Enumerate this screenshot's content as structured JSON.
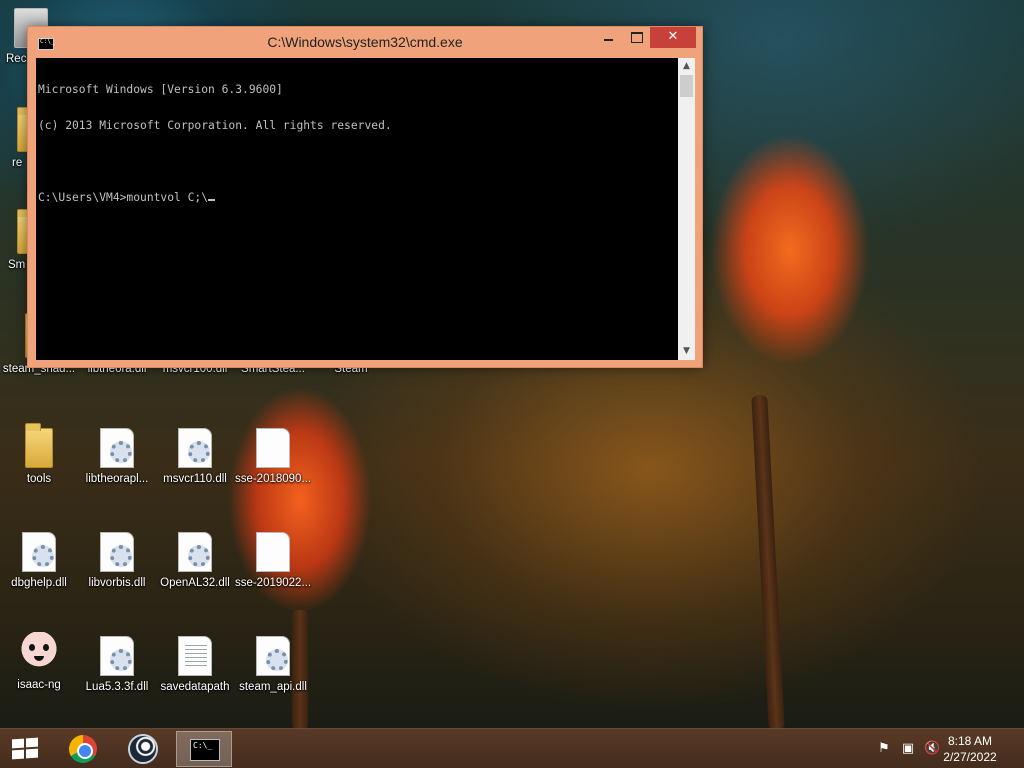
{
  "cmd": {
    "title": "C:\\Windows\\system32\\cmd.exe",
    "lines": [
      "Microsoft Windows [Version 6.3.9600]",
      "(c) 2013 Microsoft Corporation. All rights reserved.",
      "",
      "C:\\Users\\VM4>mountvol C;\\"
    ]
  },
  "desktop": {
    "partial_labels": {
      "recycle": "Rec",
      "res": "re",
      "sm": "Sm"
    },
    "row1": [
      "steam_shad...",
      "libtheora.dll",
      "msvcr100.dll",
      "SmartStea...",
      "Steam"
    ],
    "row2": [
      "tools",
      "libtheorapl...",
      "msvcr110.dll",
      "sse-2018090..."
    ],
    "row3": [
      "dbghelp.dll",
      "libvorbis.dll",
      "OpenAL32.dll",
      "sse-2019022..."
    ],
    "row4": [
      "isaac-ng",
      "Lua5.3.3f.dll",
      "savedatapath",
      "steam_api.dll"
    ]
  },
  "taskbar": {
    "apps": [
      "chrome-icon",
      "steam-icon",
      "cmd-icon"
    ],
    "time": "8:18 AM",
    "date": "2/27/2022"
  },
  "colors": {
    "cmd_frame": "#f0a37a",
    "close_button": "#c7413a",
    "console_bg": "#000000",
    "console_text": "#c0c0c0"
  }
}
